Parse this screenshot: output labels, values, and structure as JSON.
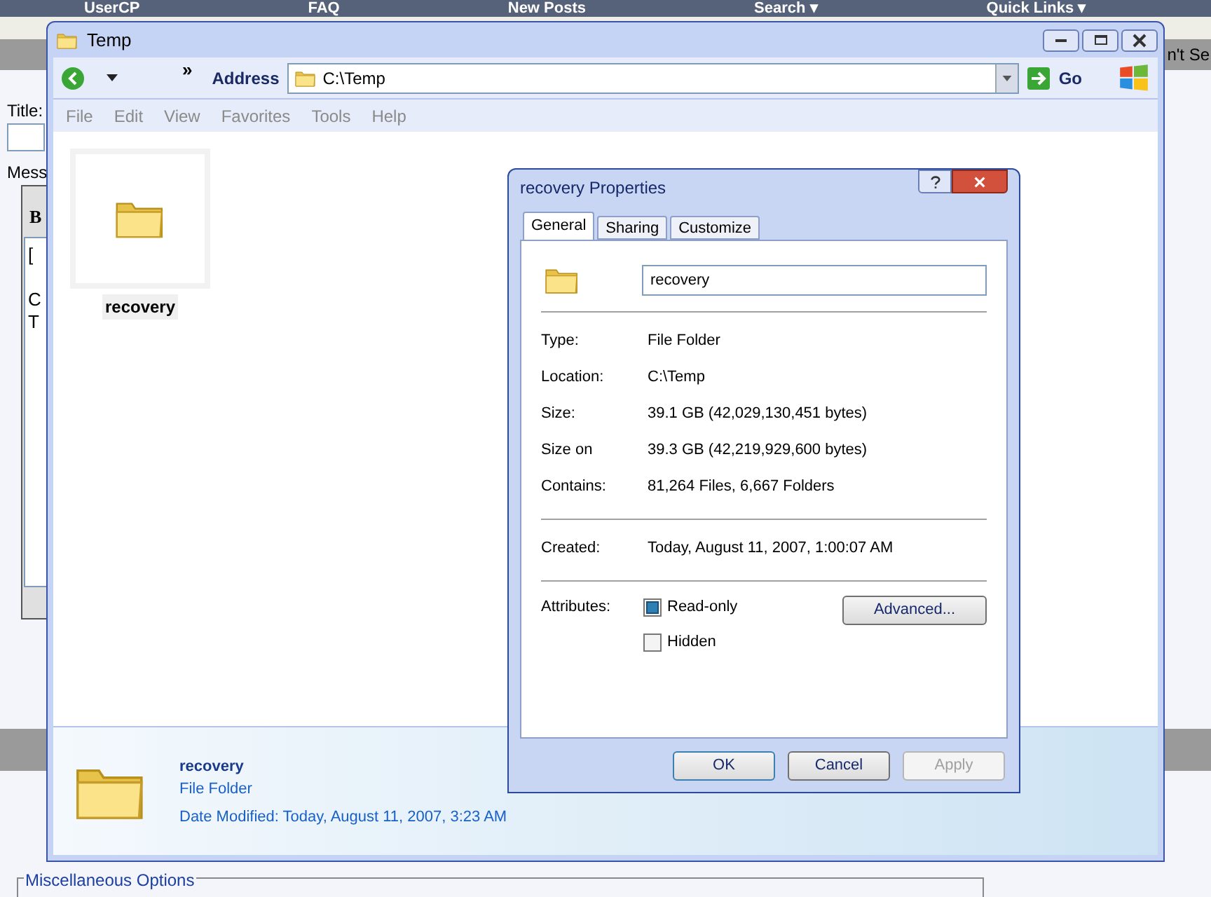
{
  "background_page": {
    "nav_links": [
      "UserCP",
      "FAQ",
      "New Posts",
      "Search ▾",
      "Quick Links ▾"
    ],
    "cut_text": "n't Se",
    "title_label": "Title:",
    "message_label": "Mess",
    "editor_button": "B",
    "editor_paragraphs": [
      [
        "["
      ],
      [
        "C",
        "T"
      ]
    ],
    "misc_legend": "Miscellaneous Options"
  },
  "explorer": {
    "title": "Temp",
    "address_label": "Address",
    "address": "C:\\Temp",
    "go": "Go",
    "chevron": "»",
    "menu": [
      "File",
      "Edit",
      "View",
      "Favorites",
      "Tools",
      "Help"
    ],
    "items": [
      {
        "name": "recovery",
        "selected": true
      }
    ],
    "details": {
      "name": "recovery",
      "type": "File Folder",
      "modified": "Date Modified: Today, August 11, 2007, 3:23 AM"
    }
  },
  "dialog": {
    "title": "recovery Properties",
    "tabs": [
      {
        "label": "General",
        "selected": true
      },
      {
        "label": "Sharing",
        "selected": false
      },
      {
        "label": "Customize",
        "selected": false
      }
    ],
    "name_value": "recovery",
    "groups": [
      [
        {
          "label": "Type:",
          "value": "File Folder"
        },
        {
          "label": "Location:",
          "value": "C:\\Temp"
        },
        {
          "label": "Size:",
          "value": "39.1 GB (42,029,130,451 bytes)"
        },
        {
          "label": "Size on",
          "value": "39.3 GB (42,219,929,600 bytes)"
        },
        {
          "label": "Contains:",
          "value": "81,264 Files, 6,667 Folders"
        }
      ],
      [
        {
          "label": "Created:",
          "value": "Today, August 11, 2007, 1:00:07 AM"
        }
      ]
    ],
    "attributes_label": "Attributes:",
    "attributes": [
      {
        "label": "Read-only",
        "checked": true
      },
      {
        "label": "Hidden",
        "checked": false
      }
    ],
    "advanced": "Advanced...",
    "buttons": [
      {
        "label": "OK",
        "default": true,
        "disabled": false
      },
      {
        "label": "Cancel",
        "default": false,
        "disabled": false
      },
      {
        "label": "Apply",
        "default": false,
        "disabled": true
      }
    ]
  }
}
